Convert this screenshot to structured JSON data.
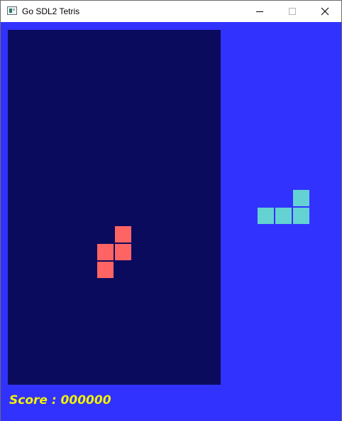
{
  "window": {
    "title": "Go SDL2 Tetris"
  },
  "icons": {
    "app": "window-app-icon",
    "minimize": "minimize-icon",
    "maximize": "maximize-icon",
    "close": "close-icon"
  },
  "colors": {
    "background": "#3232ff",
    "board": "#0b0b5e",
    "active_piece": "#ff6464",
    "next_piece": "#64d2d2",
    "score_text": "#f2f200"
  },
  "board": {
    "columns": 12,
    "rows": 20,
    "active_piece": {
      "shape": "S",
      "color": "#ff6464",
      "cells": [
        [
          6,
          11
        ],
        [
          5,
          12
        ],
        [
          6,
          12
        ],
        [
          5,
          13
        ]
      ]
    }
  },
  "next_piece": {
    "shape": "L",
    "color": "#64d2d2",
    "cells": [
      [
        2,
        0
      ],
      [
        0,
        1
      ],
      [
        1,
        1
      ],
      [
        2,
        1
      ]
    ]
  },
  "score": {
    "label": "Score : 000000"
  }
}
